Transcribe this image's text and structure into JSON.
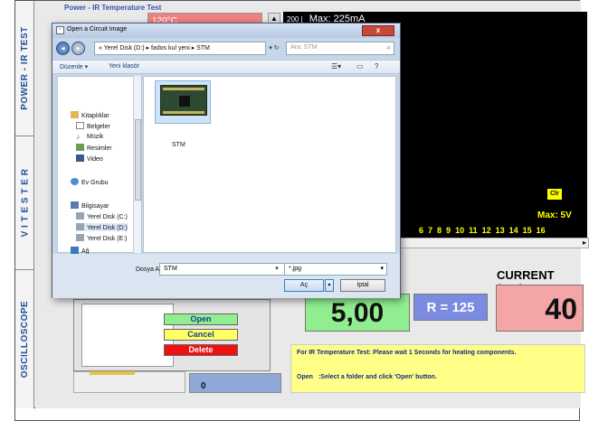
{
  "tabs": [
    {
      "label": "POWER - IR TEST"
    },
    {
      "label": "V I  T E S T E R"
    },
    {
      "label": "OSCILLOSCOPE"
    }
  ],
  "power_test": {
    "group_title": "Power - IR Temperature Test",
    "temperature": "120°C"
  },
  "scope": {
    "small_value": "200 |",
    "max_current": "Max: 225mA",
    "clear_label": "Clr",
    "max_voltage": "Max: 5V",
    "x_ticks": [
      "6",
      "7",
      "8",
      "9",
      "10",
      "11",
      "12",
      "13",
      "14",
      "15",
      "16"
    ]
  },
  "readings": {
    "current_label": "CURRENT (mA):",
    "voltage": "5,00",
    "resistance": "R = 125",
    "current": "40",
    "count": "0"
  },
  "buttons": {
    "open": "Open",
    "cancel": "Cancel",
    "delete": "Delete"
  },
  "info": {
    "line1": "For IR Temperature Test: Please wait 1 Seconds for heating components.",
    "line2_key": "Open",
    "line2_text": ":Select a folder and click 'Open' button."
  },
  "dialog": {
    "title": "Open a Circuit Image",
    "address": "« Yerel Disk (D:) ▸ fados kul yeni ▸ STM",
    "search_placeholder": "Ara: STM",
    "toolbar": {
      "organize": "Düzenle ▾",
      "new_folder": "Yeni klasör"
    },
    "nav": {
      "libraries": "Kitaplıklar",
      "documents": "Belgeler",
      "music": "Müzik",
      "pictures": "Resimler",
      "video": "Video",
      "homegroup": "Ev Grubu",
      "computer": "Bilgisayar",
      "disk_c": "Yerel Disk (C:)",
      "disk_d": "Yerel Disk (D:)",
      "disk_e": "Yerel Disk (E:)",
      "network": "Ağ"
    },
    "file_item": "STM",
    "filename_label": "Dosya Adı:",
    "filename_value": "STM",
    "filetype_value": "*.jpg",
    "open_label": "Aç",
    "cancel_label": "İptal",
    "icons": {
      "back": "back-arrow-icon",
      "forward": "forward-arrow-icon",
      "refresh": "refresh-icon",
      "search": "search-icon",
      "close": "close-icon"
    }
  }
}
